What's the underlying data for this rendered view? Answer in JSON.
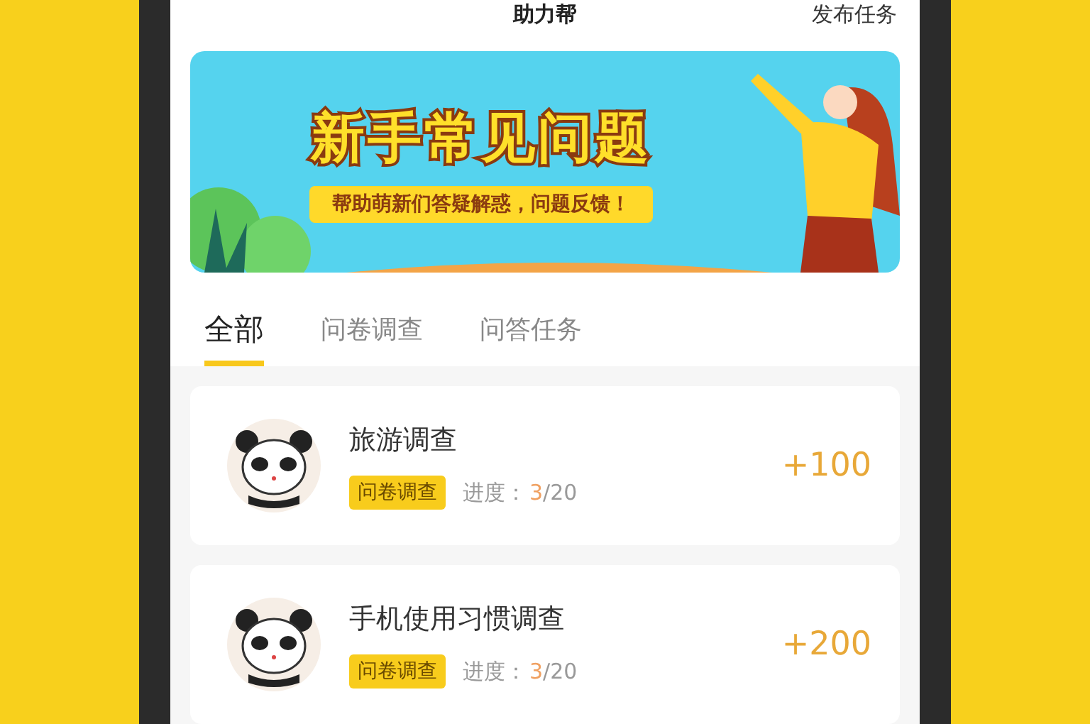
{
  "header": {
    "title": "助力帮",
    "action": "发布任务"
  },
  "banner": {
    "title": "新手常见问题",
    "subtitle": "帮助萌新们答疑解惑，问题反馈！"
  },
  "tabs": [
    {
      "label": "全部",
      "selected": true
    },
    {
      "label": "问卷调查",
      "selected": false
    },
    {
      "label": "问答任务",
      "selected": false
    }
  ],
  "tasks": [
    {
      "title": "旅游调查",
      "tag": "问卷调查",
      "progress_label": "进度：",
      "progress_current": "3",
      "progress_total": "/20",
      "reward": "+100"
    },
    {
      "title": "手机使用习惯调查",
      "tag": "问卷调查",
      "progress_label": "进度：",
      "progress_current": "3",
      "progress_total": "/20",
      "reward": "+200"
    }
  ]
}
